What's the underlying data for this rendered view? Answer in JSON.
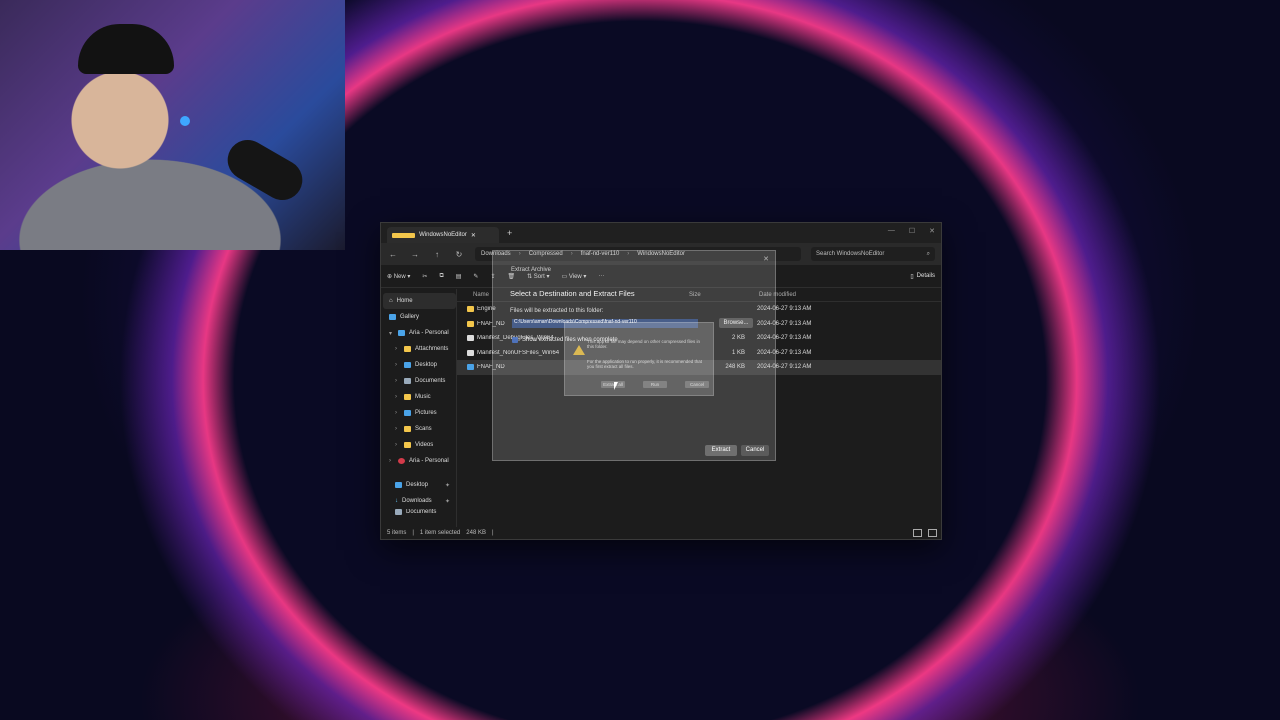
{
  "webcam": {},
  "explorer": {
    "tab_title": "WindowsNoEditor",
    "new_tab": "+",
    "window_controls": {
      "minimize": "—",
      "maximize": "☐",
      "close": "✕"
    },
    "nav": {
      "back": "←",
      "forward": "→",
      "up": "↑",
      "refresh": "↻"
    },
    "breadcrumb": [
      "Downloads",
      "Compressed",
      "fnaf-nd-ver110",
      "WindowsNoEditor"
    ],
    "breadcrumb_sep": "›",
    "search_placeholder": "Search WindowsNoEditor",
    "toolbar": {
      "new": "New",
      "sort": "Sort",
      "view": "View",
      "more": "···",
      "details": "Details"
    },
    "sidebar": {
      "home": "Home",
      "gallery": "Gallery",
      "onedrive1": "Aria - Personal",
      "folders": [
        "Attachments",
        "Desktop",
        "Documents",
        "Music",
        "Pictures",
        "Scans",
        "Videos"
      ],
      "onedrive2": "Aria - Personal",
      "pinned": [
        "Desktop",
        "Downloads",
        "Documents"
      ]
    },
    "columns": {
      "name": "Name",
      "size": "Size",
      "date": "Date modified"
    },
    "files": [
      {
        "name": "Engine",
        "size": "",
        "date": "2024-06-27 9:13 AM",
        "type": "folder"
      },
      {
        "name": "FNAF_ND",
        "size": "",
        "date": "2024-06-27 9:13 AM",
        "type": "folder"
      },
      {
        "name": "Manifest_DebugFiles_Win64",
        "size": "2 KB",
        "date": "2024-06-27 9:13 AM",
        "type": "file"
      },
      {
        "name": "Manifest_NonUFSFiles_Win64",
        "size": "1 KB",
        "date": "2024-06-27 9:13 AM",
        "type": "file"
      },
      {
        "name": "FNAF_ND",
        "size": "248 KB",
        "date": "2024-06-27 9:12 AM",
        "type": "exe"
      }
    ],
    "status": {
      "items": "5 items",
      "selected": "1 item selected",
      "size": "248 KB"
    }
  },
  "extract_dialog": {
    "title": "Extract Archive",
    "heading": "Select a Destination and Extract Files",
    "label": "Files will be extracted to this folder:",
    "path": "C:\\Users\\aman\\Downloads\\Compressed\\fnaf-nd-ver110",
    "browse": "Browse...",
    "checkbox": "Show extracted files when complete",
    "extract": "Extract",
    "cancel": "Cancel",
    "close": "✕"
  },
  "warning_dialog": {
    "line1": "This app or file may depend on other compressed files in this folder.",
    "line2": "For the application to run properly, it is recommended that you first extract all files.",
    "btn_extract": "Extract all",
    "btn_run": "Run",
    "btn_cancel": "Cancel"
  }
}
